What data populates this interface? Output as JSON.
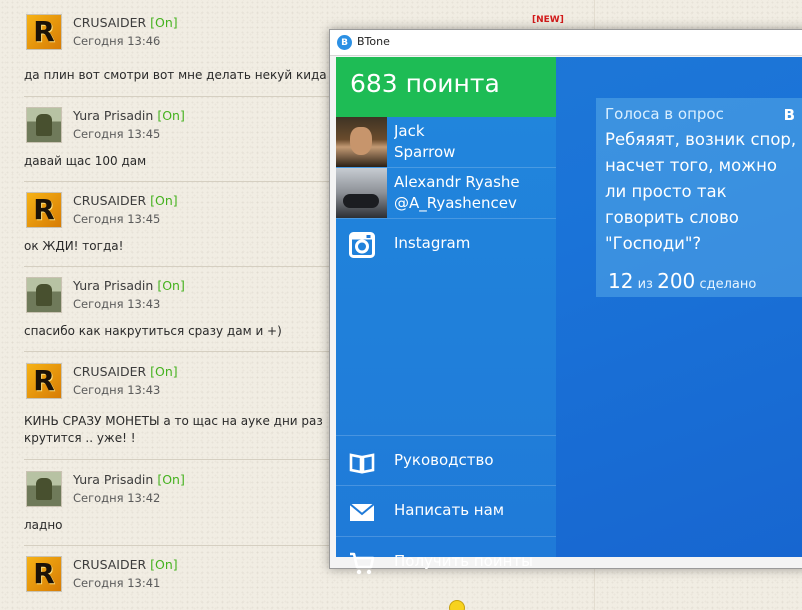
{
  "chat": {
    "new_badge": "[NEW]",
    "messages": [
      {
        "user": "CRUSAIDER",
        "status": "[On]",
        "time": "Сегодня 13:46",
        "text": "да плин вот смотри вот мне делать некуй кида",
        "avatar": "r-logo-icon"
      },
      {
        "user": "Yura Prisadin",
        "status": "[On]",
        "time": "Сегодня 13:45",
        "text": "давай щас 100 дам",
        "avatar": "soldier-avatar"
      },
      {
        "user": "CRUSAIDER",
        "status": "[On]",
        "time": "Сегодня 13:45",
        "text": "ок ЖДИ! тогда!",
        "avatar": "r-logo-icon"
      },
      {
        "user": "Yura Prisadin",
        "status": "[On]",
        "time": "Сегодня 13:43",
        "text": "спасибо как накрутиться сразу дам и +)",
        "avatar": "soldier-avatar"
      },
      {
        "user": "CRUSAIDER",
        "status": "[On]",
        "time": "Сегодня 13:43",
        "text": "КИНЬ СРАЗУ МОНЕТЫ а то щас на ауке дни раз",
        "text2": "крутится .. уже! !",
        "avatar": "r-logo-icon"
      },
      {
        "user": "Yura Prisadin",
        "status": "[On]",
        "time": "Сегодня 13:42",
        "text": "ладно",
        "avatar": "soldier-avatar"
      },
      {
        "user": "CRUSAIDER",
        "status": "[On]",
        "time": "Сегодня 13:41",
        "text": "",
        "avatar": "r-logo-icon"
      }
    ]
  },
  "window": {
    "title": "BTone",
    "icon_letter": "B"
  },
  "app": {
    "points_label": "683 поинта",
    "accounts": [
      {
        "name": "Jack\nSparrow"
      },
      {
        "name": "Alexandr Ryashe\n@A_Ryashencev"
      }
    ],
    "instagram_label": "Instagram",
    "menu": {
      "guide": "Руководство",
      "contact": "Написать нам",
      "get_points": "Получить поинты"
    },
    "poll": {
      "header": "Голоса в опрос",
      "network_badge": "B",
      "question": "Ребяяят, возник спор, насчет того, можно ли просто так говорить слово \"Господи\"?",
      "done": "12",
      "of": "из",
      "total": "200",
      "done_label": "сделано"
    }
  },
  "colors": {
    "points_bg": "#1ebc55",
    "client_bg": "#1a73d8",
    "online": "#45b21f",
    "new_badge": "#d21a1a"
  }
}
